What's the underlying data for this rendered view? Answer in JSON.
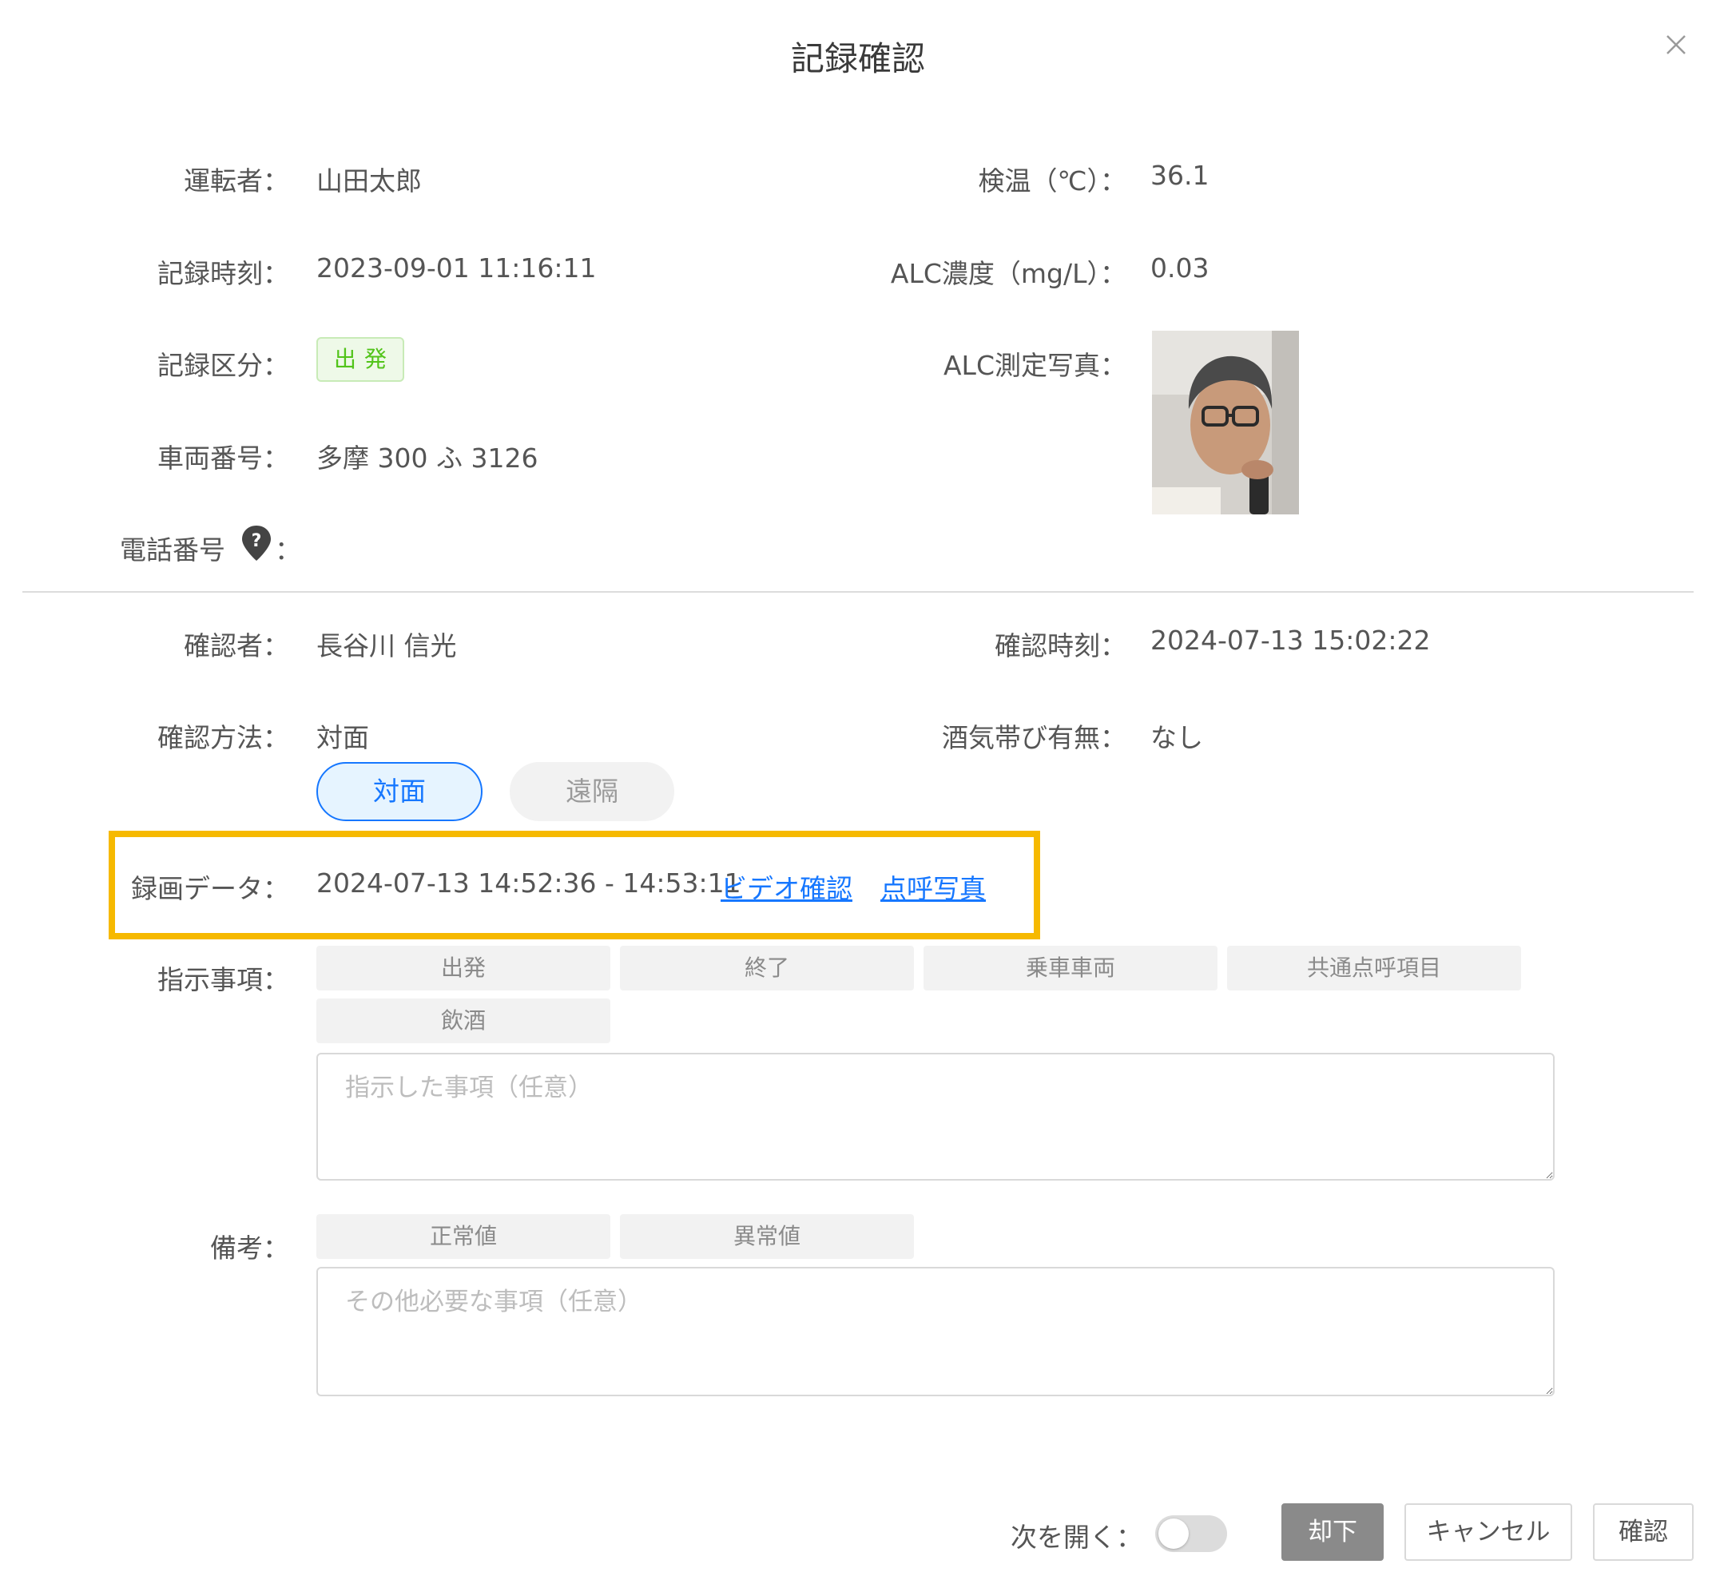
{
  "dialog": {
    "title": "記録確認"
  },
  "record": {
    "driver_label": "運転者：",
    "driver_value": "山田太郎",
    "temp_label": "検温（℃）：",
    "temp_value": "36.1",
    "time_label": "記録時刻：",
    "time_value": "2023-09-01 11:16:11",
    "alc_label": "ALC濃度（mg/L）：",
    "alc_value": "0.03",
    "category_label": "記録区分：",
    "category_value": "出発",
    "alc_photo_label": "ALC測定写真：",
    "vehicle_label": "車両番号：",
    "vehicle_value": "多摩 300 ふ 3126",
    "phone_label": "電話番号",
    "phone_colon": "："
  },
  "confirm": {
    "confirmer_label": "確認者：",
    "confirmer_value": "長谷川 信光",
    "confirm_time_label": "確認時刻：",
    "confirm_time_value": "2024-07-13 15:02:22",
    "method_label": "確認方法：",
    "method_value": "対面",
    "alcohol_label": "酒気帯び有無：",
    "alcohol_value": "なし",
    "method_options": [
      "対面",
      "遠隔"
    ],
    "selected_method": "対面"
  },
  "recording": {
    "label": "録画データ：",
    "range": "2024-07-13 14:52:36 - 14:53:11",
    "video_link": "ビデオ確認",
    "photo_link": "点呼写真"
  },
  "instructions": {
    "label": "指示事項：",
    "chips": [
      "出発",
      "終了",
      "乗車車両",
      "共通点呼項目",
      "飲酒"
    ],
    "placeholder": "指示した事項（任意）"
  },
  "remarks": {
    "label": "備考：",
    "chips": [
      "正常値",
      "異常値"
    ],
    "placeholder": "その他必要な事項（任意）"
  },
  "footer": {
    "next_open_label": "次を開く：",
    "next_open_enabled": false,
    "reject_label": "却下",
    "cancel_label": "キャンセル",
    "confirm_label": "確認"
  },
  "colors": {
    "accent": "#1677ff",
    "highlight": "#f6b900",
    "tag_green": "#52c41a",
    "reject_gray": "#8a8a8a"
  },
  "icons": {
    "close": "close-icon",
    "help": "help-location-icon"
  }
}
